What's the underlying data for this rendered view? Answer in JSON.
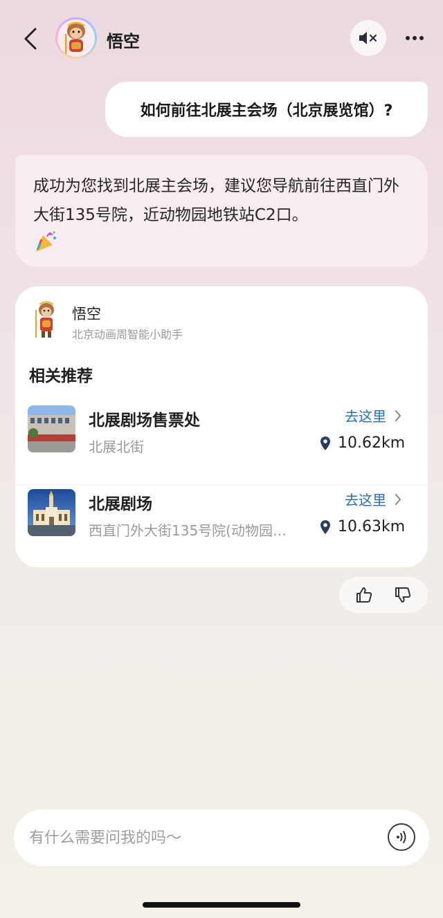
{
  "header": {
    "title": "悟空",
    "back_icon": "chevron-left-icon",
    "mute_icon": "speaker-mute-icon",
    "more_icon": "more-dots-icon"
  },
  "messages": {
    "user": "如何前往北展主会场（北京展览馆）?",
    "bot": "成功为您找到北展主会场，建议您导航前往西直门外大街135号院，近动物园地铁站C2口。"
  },
  "card": {
    "name": "悟空",
    "subtitle": "北京动画周智能小助手",
    "section_title": "相关推荐",
    "places": [
      {
        "name": "北展剧场售票处",
        "address": "北展北街",
        "action": "去这里",
        "distance": "10.62km"
      },
      {
        "name": "北展剧场",
        "address": "西直门外大街135号院(动物园…",
        "action": "去这里",
        "distance": "10.63km"
      }
    ]
  },
  "feedback": {
    "like_icon": "thumbs-up-icon",
    "dislike_icon": "thumbs-down-icon"
  },
  "input": {
    "placeholder": "有什么需要问我的吗～",
    "voice_icon": "voice-wave-icon"
  },
  "colors": {
    "link": "#2a6fb6",
    "gray_text": "#9a9a9a"
  }
}
